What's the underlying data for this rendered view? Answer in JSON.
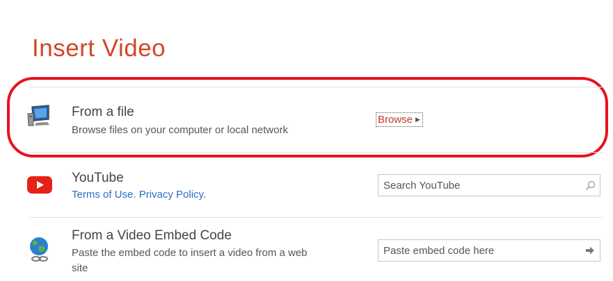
{
  "dialog": {
    "title": "Insert Video"
  },
  "from_file": {
    "title": "From a file",
    "description": "Browse files on your computer or local network",
    "browse_label": "Browse"
  },
  "youtube": {
    "title": "YouTube",
    "terms_link": "Terms of Use.",
    "privacy_link": "Privacy Policy.",
    "search_placeholder": "Search YouTube"
  },
  "embed": {
    "title": "From a Video Embed Code",
    "description_line1": "Paste the embed code to insert a video from a web",
    "description_line2": "site",
    "input_placeholder": "Paste embed code here"
  },
  "colors": {
    "title": "#d24726",
    "highlight": "#e8121f",
    "link": "#2a6fc5",
    "youtube_red": "#e62117"
  },
  "icons": {
    "from_file": "computer-monitor-icon",
    "youtube": "youtube-play-icon",
    "embed": "globe-link-icon",
    "search": "search-icon",
    "go": "arrow-right-icon"
  }
}
